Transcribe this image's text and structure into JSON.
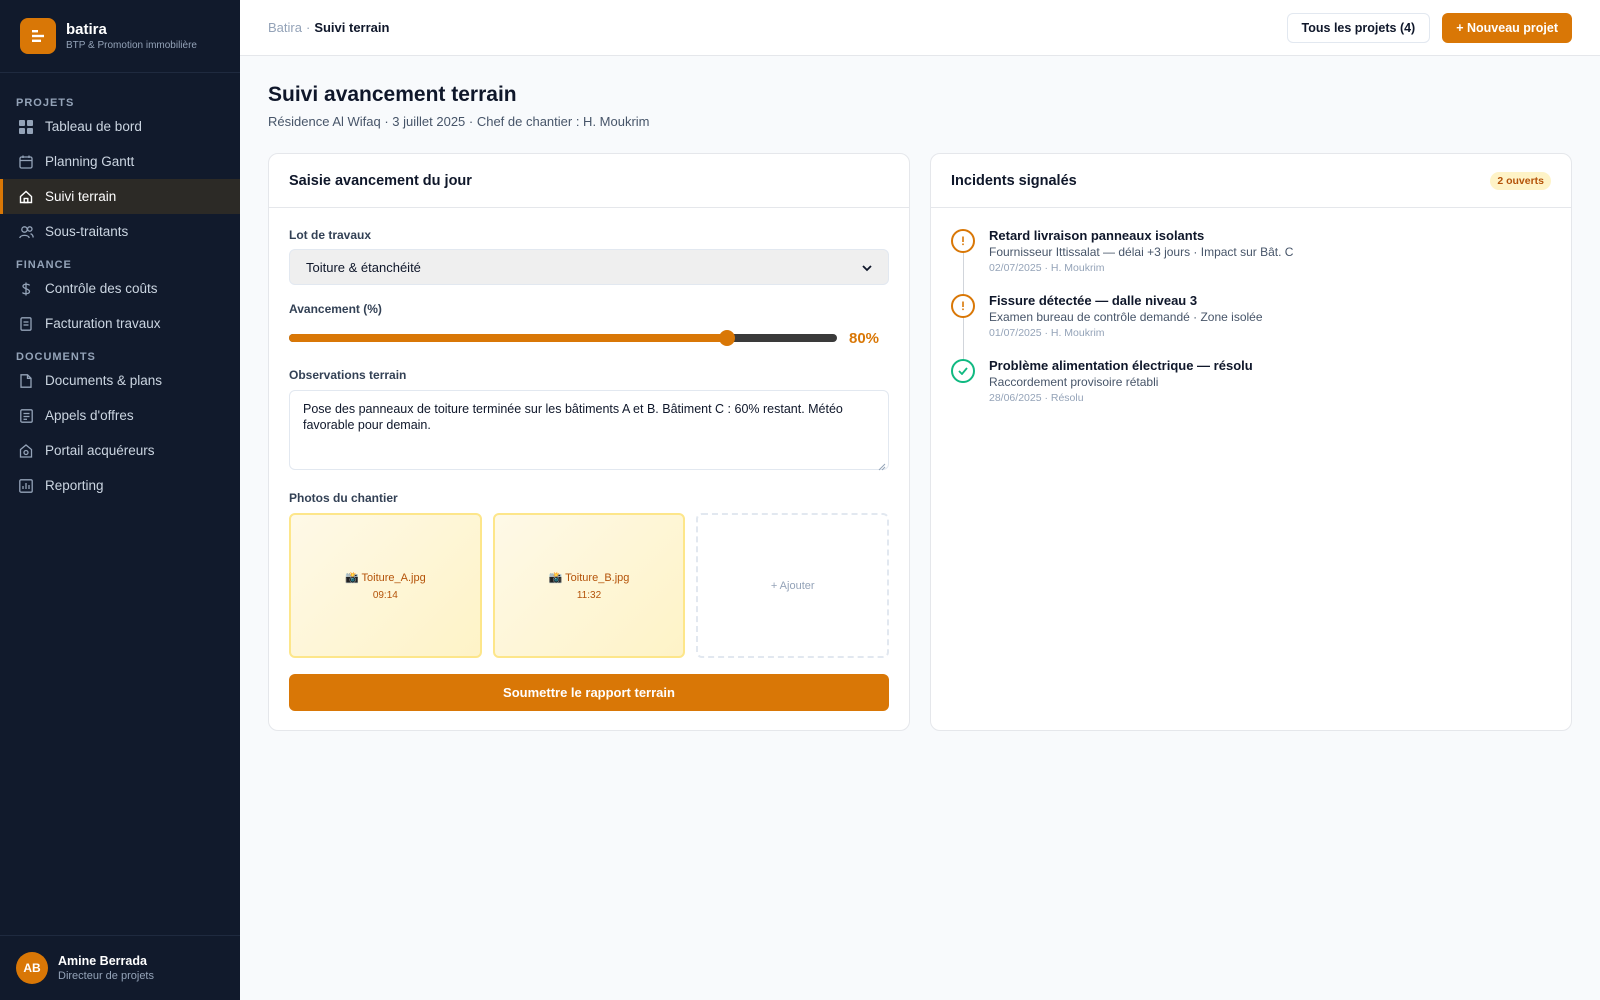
{
  "brand": {
    "name": "batira",
    "tagline": "BTP & Promotion immobilière"
  },
  "nav": {
    "sections": [
      {
        "title": "PROJETS",
        "items": [
          {
            "label": "Tableau de bord",
            "icon": "grid-icon",
            "active": false
          },
          {
            "label": "Planning Gantt",
            "icon": "calendar-icon",
            "active": false
          },
          {
            "label": "Suivi terrain",
            "icon": "home-icon",
            "active": true
          },
          {
            "label": "Sous-traitants",
            "icon": "users-icon",
            "active": false
          }
        ]
      },
      {
        "title": "FINANCE",
        "items": [
          {
            "label": "Contrôle des coûts",
            "icon": "dollar-icon",
            "active": false
          },
          {
            "label": "Facturation travaux",
            "icon": "invoice-icon",
            "active": false
          }
        ]
      },
      {
        "title": "DOCUMENTS",
        "items": [
          {
            "label": "Documents & plans",
            "icon": "file-icon",
            "active": false
          },
          {
            "label": "Appels d'offres",
            "icon": "list-icon",
            "active": false
          },
          {
            "label": "Portail acquéreurs",
            "icon": "portal-icon",
            "active": false
          },
          {
            "label": "Reporting",
            "icon": "chart-icon",
            "active": false
          }
        ]
      }
    ]
  },
  "user": {
    "initials": "AB",
    "name": "Amine Berrada",
    "role": "Directeur de projets"
  },
  "breadcrumb": {
    "root": "Batira",
    "sep": "·",
    "current": "Suivi terrain"
  },
  "topbar": {
    "all_projects": "Tous les projets (4)",
    "new_project": "+ Nouveau projet"
  },
  "page": {
    "title": "Suivi avancement terrain",
    "subtitle": "Résidence Al Wifaq · 3 juillet 2025 · Chef de chantier : H. Moukrim"
  },
  "entry": {
    "title": "Saisie avancement du jour",
    "lot_label": "Lot de travaux",
    "lot_value": "Toiture & étanchéité",
    "progress_label": "Avancement (%)",
    "progress_value": 80,
    "progress_text": "80%",
    "obs_label": "Observations terrain",
    "obs_value": "Pose des panneaux de toiture terminée sur les bâtiments A et B. Bâtiment C : 60% restant. Météo favorable pour demain.",
    "photos_label": "Photos du chantier",
    "photos": [
      {
        "name": "📸 Toiture_A.jpg",
        "time": "09:14"
      },
      {
        "name": "📸 Toiture_B.jpg",
        "time": "11:32"
      }
    ],
    "add_photo": "+ Ajouter",
    "submit": "Soumettre le rapport terrain"
  },
  "incidents": {
    "title": "Incidents signalés",
    "badge": "2 ouverts",
    "items": [
      {
        "title": "Retard livraison panneaux isolants",
        "desc": "Fournisseur Ittissalat — délai +3 jours · Impact sur Bât. C",
        "meta": "02/07/2025 · H. Moukrim",
        "status": "warn"
      },
      {
        "title": "Fissure détectée — dalle niveau 3",
        "desc": "Examen bureau de contrôle demandé · Zone isolée",
        "meta": "01/07/2025 · H. Moukrim",
        "status": "warn"
      },
      {
        "title": "Problème alimentation électrique — résolu",
        "desc": "Raccordement provisoire rétabli",
        "meta": "28/06/2025 · Résolu",
        "status": "ok"
      }
    ]
  },
  "colors": {
    "accent": "#d97706",
    "sidebar": "#111a2c",
    "success": "#10b981"
  }
}
